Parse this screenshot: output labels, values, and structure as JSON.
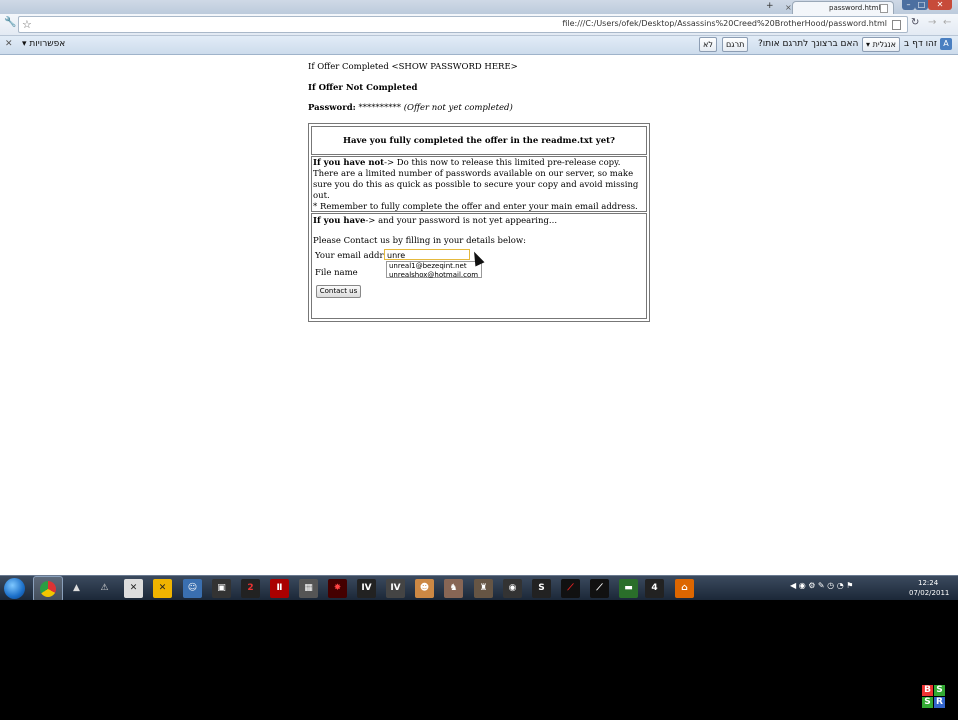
{
  "browser": {
    "tab_title": "password.html",
    "url": "file:///C:/Users/ofek/Desktop/Assassins%20Creed%20BrotherHood/password.html"
  },
  "infobar": {
    "options": "אפשרויות",
    "no": "לא",
    "translate": "תרגם",
    "question": "?האם ברצונך לתרגם אותו",
    "language": "אנגלית",
    "page_is": "זהו דף ב"
  },
  "page": {
    "line1": "If Offer Completed <SHOW PASSWORD HERE>",
    "line2": "If Offer Not Completed",
    "password_label": "Password:",
    "password_value": " ********** ",
    "password_note": "(Offer not yet completed)",
    "question": "Have you fully completed the offer in the readme.txt yet?",
    "not_label": "If you have not",
    "not_text": "-> Do this now to release this limited pre-release copy. There are a limited number of passwords available on our server, so make sure you do this as quick as possible to secure your copy and avoid missing out.",
    "remember": "* Remember to fully complete the offer and enter your main email address.",
    "have_label": "If you have",
    "have_text": "-> and your password is not yet appearing...",
    "please_contact": "Please Contact us by filling in your details below:",
    "email_label": "Your email address",
    "email_value": "unre",
    "filename_label": "File name",
    "suggestions": [
      "unreal1@bezeqint.net",
      "unrealshox@hotmail.com"
    ],
    "contact_button": "Contact us"
  },
  "taskbar": {
    "time": "12:24",
    "date": "07/02/2011"
  },
  "logo": [
    "B",
    "S",
    "S",
    "R"
  ]
}
